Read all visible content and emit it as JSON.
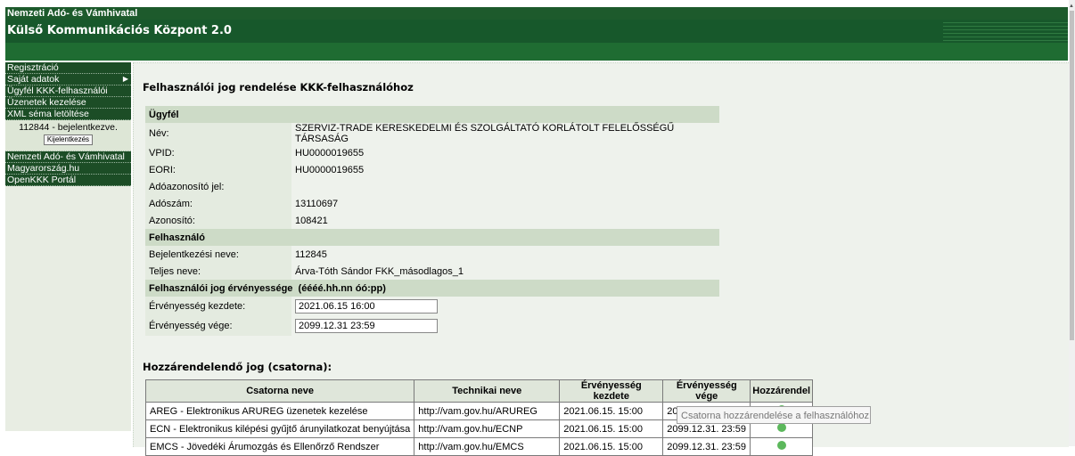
{
  "header": {
    "org": "Nemzeti Adó- és Vámhivatal",
    "app_title": "Külső Kommunikációs Központ 2.0"
  },
  "sidebar": {
    "items_top": [
      {
        "label": "Regisztráció"
      },
      {
        "label": "Saját adatok",
        "submenu": true
      },
      {
        "label": "Ügyfél KKK-felhasználói"
      },
      {
        "label": "Üzenetek kezelése"
      },
      {
        "label": "XML séma letöltése"
      }
    ],
    "login_status": "112844 - bejelentkezve.",
    "logout_label": "Kijelentkezés",
    "items_bottom": [
      {
        "label": "Nemzeti Adó- és Vámhivatal"
      },
      {
        "label": "Magyarország.hu"
      },
      {
        "label": "OpenKKK Portál"
      }
    ]
  },
  "main": {
    "title": "Felhasználói jog rendelése KKK-felhasználóhoz",
    "client": {
      "section": "Ügyfél",
      "rows": [
        {
          "label": "Név:",
          "value": "SZERVIZ-TRADE KERESKEDELMI ÉS SZOLGÁLTATÓ KORLÁTOLT FELELŐSSÉGŰ TÁRSASÁG"
        },
        {
          "label": "VPID:",
          "value": "HU0000019655"
        },
        {
          "label": "EORI:",
          "value": "HU0000019655"
        },
        {
          "label": "Adóazonosító jel:",
          "value": ""
        },
        {
          "label": "Adószám:",
          "value": "13110697"
        },
        {
          "label": "Azonosító:",
          "value": "108421"
        }
      ]
    },
    "user": {
      "section": "Felhasználó",
      "rows": [
        {
          "label": "Bejelentkezési neve:",
          "value": "112845"
        },
        {
          "label": "Teljes neve:",
          "value": "Árva-Tóth Sándor FKK_másodlagos_1"
        }
      ]
    },
    "validity": {
      "section": "Felhasználói jog érvényessége",
      "format": "(éééé.hh.nn óó:pp)",
      "start_label": "Érvényesség kezdete:",
      "start_value": "2021.06.15 16:00",
      "end_label": "Érvényesség vége:",
      "end_value": "2099.12.31 23:59"
    },
    "channels": {
      "title": "Hozzárendelendő jog (csatorna):",
      "headers": [
        "Csatorna neve",
        "Technikai neve",
        "Érvényesség kezdete",
        "Érvényesség vége",
        "Hozzárendel"
      ],
      "rows": [
        {
          "name": "AREG - Elektronikus ARUREG üzenetek kezelése",
          "tech": "http://vam.gov.hu/ARUREG",
          "start": "2021.06.15. 15:00",
          "end": "2099.12.31. 23:59"
        },
        {
          "name": "ECN - Elektronikus kilépési gyűjtő árunyilatkozat benyújtása",
          "tech": "http://vam.gov.hu/ECNP",
          "start": "2021.06.15. 15:00",
          "end": "2099.12.31. 23:59"
        },
        {
          "name": "EMCS - Jövedéki Árumozgás és Ellenőrző Rendszer",
          "tech": "http://vam.gov.hu/EMCS",
          "start": "2021.06.15. 15:00",
          "end": "2099.12.31. 23:59"
        }
      ]
    },
    "tooltip": "Csatorna hozzárendelése a felhasználóhoz"
  },
  "colors": {
    "header_green": "#1d5a2c",
    "section_bg": "#cddbc7",
    "assign_icon": "#5cb85c"
  }
}
